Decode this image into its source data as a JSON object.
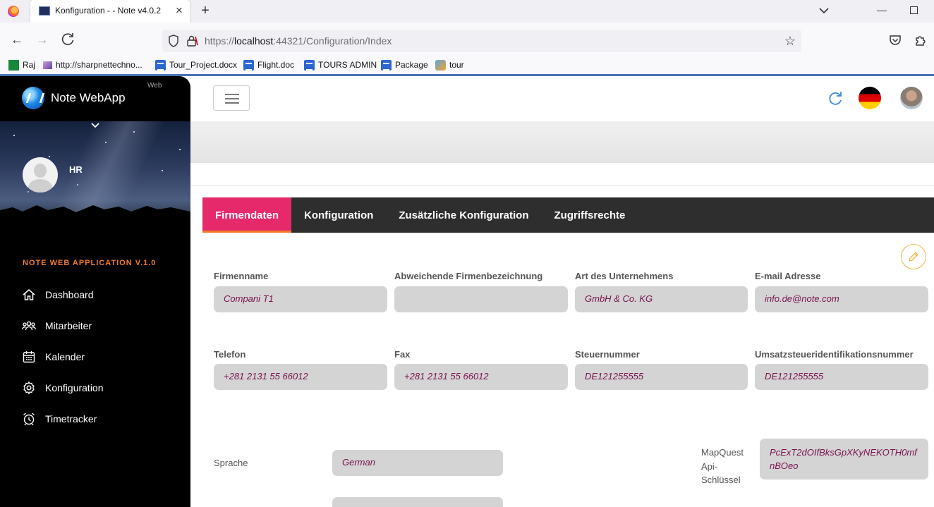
{
  "browser": {
    "tab_title": "Konfiguration - - Note v4.0.2",
    "url_prefix": "https://",
    "url_host": "localhost",
    "url_rest": ":44321/Configuration/Index",
    "bookmarks": [
      "Raj",
      "http://sharpnettechno...",
      "Tour_Project.docx",
      "Flight.doc",
      "TOURS ADMIN",
      "Package",
      "tour"
    ]
  },
  "sidebar": {
    "brand": "Note WebApp",
    "brand_badge": "Web",
    "user_name": "HR",
    "section_title": "NOTE WEB APPLICATION V.1.0",
    "items": [
      {
        "label": "Dashboard",
        "icon": "home-icon"
      },
      {
        "label": "Mitarbeiter",
        "icon": "users-icon"
      },
      {
        "label": "Kalender",
        "icon": "calendar-icon"
      },
      {
        "label": "Konfiguration",
        "icon": "gear-icon"
      },
      {
        "label": "Timetracker",
        "icon": "alarm-clock-icon"
      }
    ]
  },
  "tabs": [
    "Firmendaten",
    "Konfiguration",
    "Zusätzliche Konfiguration",
    "Zugriffsrechte"
  ],
  "active_tab": "Firmendaten",
  "form": {
    "row1": [
      {
        "label": "Firmenname",
        "value": "Compani T1"
      },
      {
        "label": "Abweichende Firmenbezeichnung",
        "value": ""
      },
      {
        "label": "Art des Unternehmens",
        "value": "GmbH & Co. KG"
      },
      {
        "label": "E-mail Adresse",
        "value": "info.de@note.com"
      }
    ],
    "row2": [
      {
        "label": "Telefon",
        "value": "+281 2131 55 66012"
      },
      {
        "label": "Fax",
        "value": "+281 2131 55 66012"
      },
      {
        "label": "Steuernummer",
        "value": "DE121255555"
      },
      {
        "label": "Umsatzsteueridentifikationsnummer",
        "value": "DE121255555"
      }
    ],
    "language_label": "Sprache",
    "language_value": "German",
    "api_label": "MapQuest Api-Schlüssel",
    "api_value": "PcExT2dOIfBksGpXKyNEKOTH0mfnBOeo"
  },
  "colors": {
    "active_tab": "#e5296a",
    "tab_underline": "#f07b2a",
    "section_title": "#f07b2a",
    "input_text": "#7a1150",
    "tabbar_bg": "#2e2e2e"
  }
}
